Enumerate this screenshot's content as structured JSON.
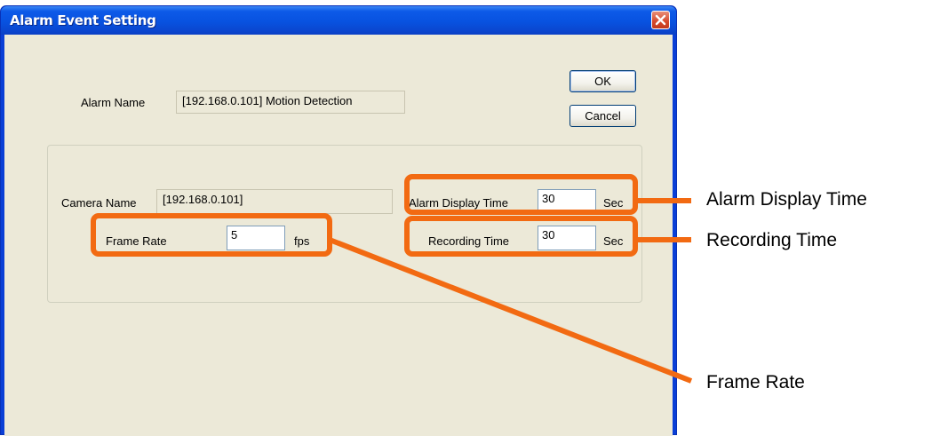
{
  "window": {
    "title": "Alarm Event Setting",
    "close_icon": "close-x-icon"
  },
  "buttons": {
    "ok": "OK",
    "cancel": "Cancel"
  },
  "alarm": {
    "label": "Alarm Name",
    "value": "[192.168.0.101] Motion Detection"
  },
  "camera": {
    "label": "Camera Name",
    "value": "[192.168.0.101]"
  },
  "frame_rate": {
    "label": "Frame Rate",
    "value": "5",
    "unit": "fps"
  },
  "alarm_display_time": {
    "label": "Alarm Display Time",
    "value": "30",
    "unit": "Sec"
  },
  "recording_time": {
    "label": "Recording Time",
    "value": "30",
    "unit": "Sec"
  },
  "callouts": {
    "alarm_display_time": "Alarm Display Time",
    "recording_time": "Recording Time",
    "frame_rate": "Frame Rate"
  },
  "colors": {
    "highlight": "#f26a12",
    "titlebar": "#0852e0",
    "dialog_face": "#ece9d8"
  }
}
